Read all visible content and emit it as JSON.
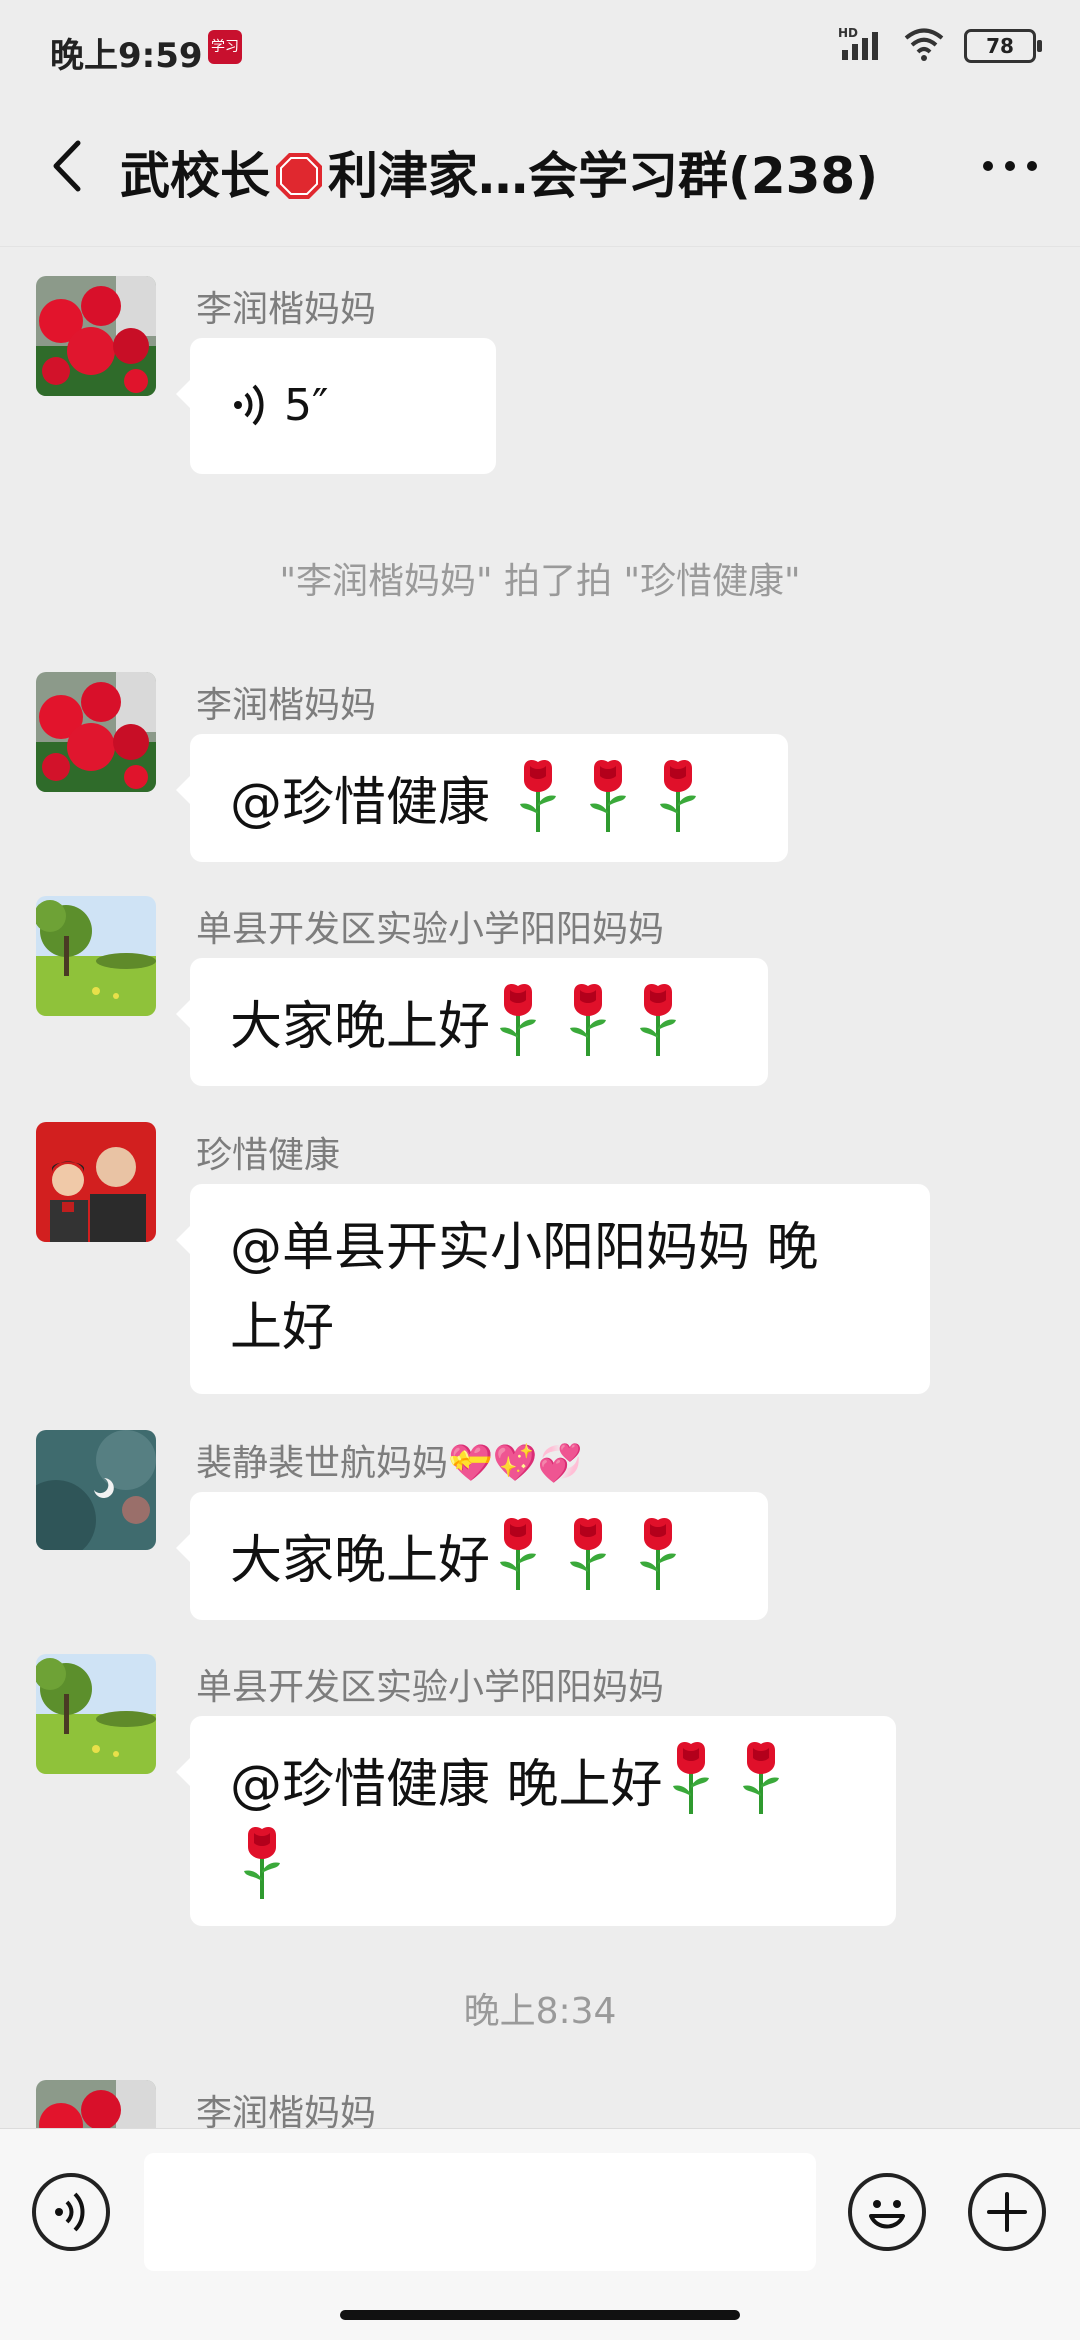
{
  "status_bar": {
    "time": "晚上9:59",
    "app_icon_text": "学习",
    "network": "HD",
    "battery": "78"
  },
  "header": {
    "title_part1": "武校长",
    "title_part2": "利津家…会学习群(238)"
  },
  "messages": [
    {
      "sender": "李润楷妈妈",
      "type": "voice",
      "duration": "5″",
      "avatar": "red-roses"
    },
    {
      "sender": "李润楷妈妈",
      "text": "@珍惜健康",
      "roses": 3,
      "avatar": "red-roses"
    },
    {
      "sender": "单县开发区实验小学阳阳妈妈",
      "text": "大家晚上好",
      "roses": 3,
      "avatar": "green-field"
    },
    {
      "sender": "珍惜健康",
      "text_line1": "@单县开实小阳阳妈妈  晚",
      "text_line2": "上好",
      "avatar": "father-son"
    },
    {
      "sender": "裴静裴世航妈妈",
      "sender_emoji": "💝💖💞",
      "text": "大家晚上好",
      "roses": 3,
      "avatar": "night-sky"
    },
    {
      "sender": "单县开发区实验小学阳阳妈妈",
      "text_line1": "@珍惜健康  晚上好",
      "roses": 3,
      "avatar": "green-field"
    },
    {
      "sender": "李润楷妈妈",
      "avatar": "red-roses"
    }
  ],
  "system": {
    "pat_notice": "\"李润楷妈妈\" 拍了拍 \"珍惜健康\"",
    "timestamp": "晚上8:34"
  },
  "input": {
    "placeholder": ""
  }
}
